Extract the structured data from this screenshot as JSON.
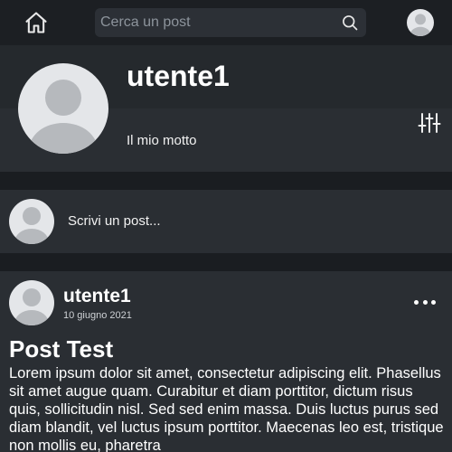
{
  "navbar": {
    "home_icon": "home-icon",
    "search": {
      "placeholder": "Cerca un post",
      "value": ""
    },
    "search_icon": "search-icon",
    "avatar_icon": "user-avatar-icon"
  },
  "profile": {
    "username": "utente1",
    "motto": "Il mio motto",
    "settings_icon": "sliders-icon"
  },
  "composer": {
    "prompt": "Scrivi un post..."
  },
  "post": {
    "author": "utente1",
    "date": "10 giugno 2021",
    "title": "Post Test",
    "body": "Lorem ipsum dolor sit amet, consectetur adipiscing elit. Phasellus sit amet augue quam. Curabitur et diam porttitor, dictum risus quis, sollicitudin nisl. Sed sed enim massa. Duis luctus purus sed diam blandit, vel luctus ipsum porttitor. Maecenas leo est, tristique non mollis eu, pharetra",
    "menu_icon": "more-horizontal-icon"
  },
  "colors": {
    "background": "#1a1d21",
    "navbar": "#1c1f23",
    "card": "#2a2e33",
    "search_field": "#2c3036",
    "avatar_bg": "#e4e6e9",
    "avatar_fg": "#b6b9bd"
  }
}
